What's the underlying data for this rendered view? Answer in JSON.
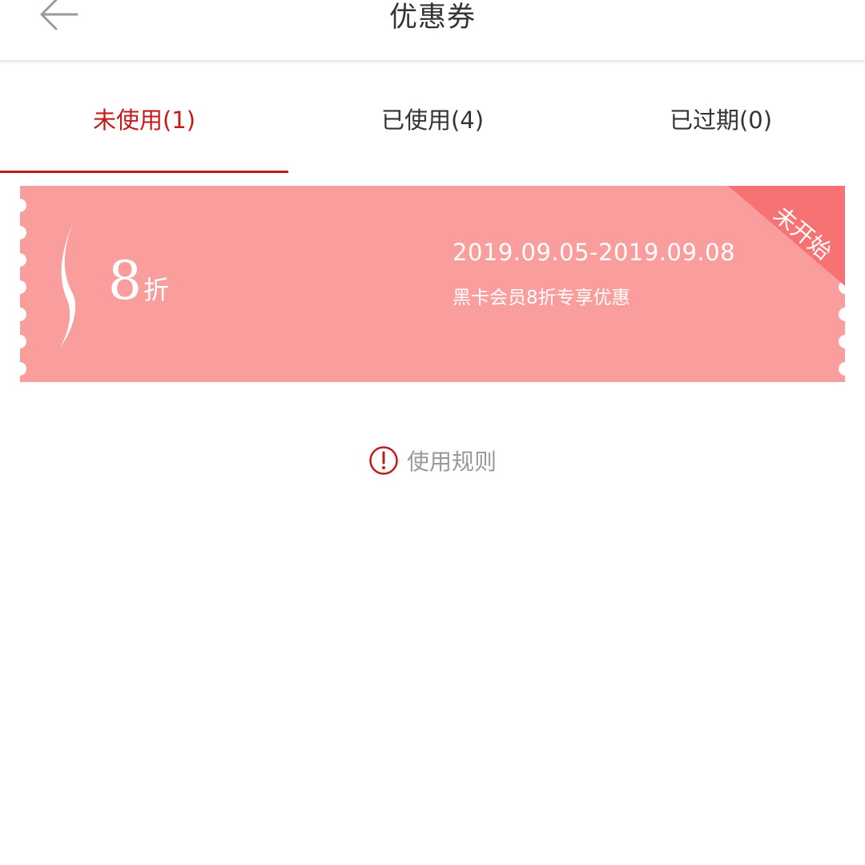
{
  "header": {
    "title": "优惠券",
    "back_icon": "arrow-left-icon"
  },
  "tabs": [
    {
      "label": "未使用(1)",
      "active": true
    },
    {
      "label": "已使用(4)",
      "active": false
    },
    {
      "label": "已过期(0)",
      "active": false
    }
  ],
  "coupon": {
    "discount_value": "8",
    "discount_unit": "折",
    "date_range": "2019.09.05-2019.09.08",
    "description": "黑卡会员8折专享优惠",
    "status_badge": "未开始",
    "background_color": "#fa9d9d",
    "badge_color": "#f77373"
  },
  "rules": {
    "label": "使用规则",
    "icon": "exclamation-circle-icon"
  },
  "colors": {
    "accent": "#c41a1a",
    "text_primary": "#333333",
    "text_muted": "#999999"
  }
}
